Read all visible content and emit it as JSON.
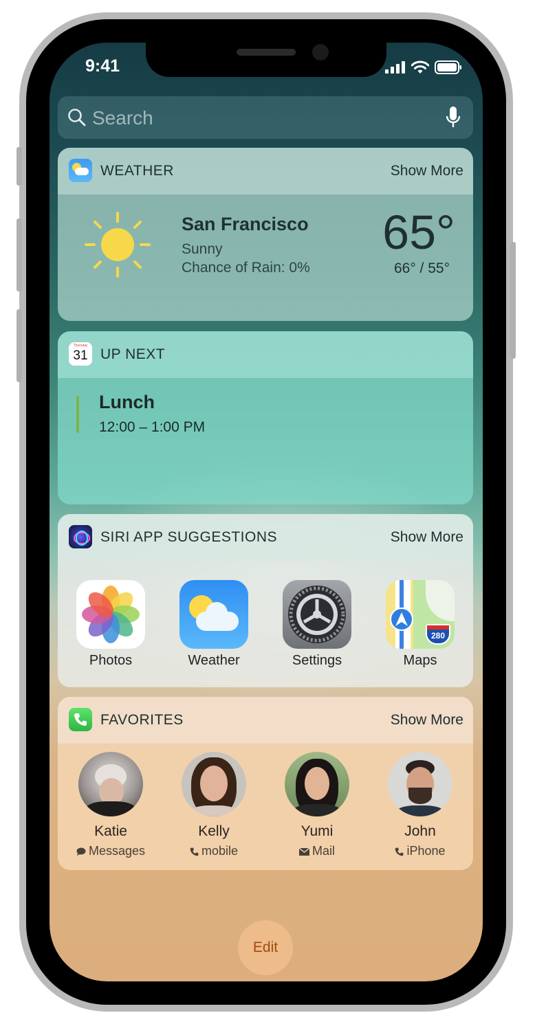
{
  "status": {
    "time": "9:41"
  },
  "search": {
    "placeholder": "Search"
  },
  "weather_widget": {
    "title": "WEATHER",
    "show_more": "Show More",
    "city": "San Francisco",
    "condition": "Sunny",
    "rain": "Chance of Rain: 0%",
    "temp": "65°",
    "hi_lo": "66° / 55°"
  },
  "upnext_widget": {
    "title": "UP NEXT",
    "calendar_day_name": "Thursday",
    "calendar_day": "31",
    "event_title": "Lunch",
    "event_time": "12:00 – 1:00 PM",
    "event_color": "#7ab648"
  },
  "siri_widget": {
    "title": "SIRI APP SUGGESTIONS",
    "show_more": "Show More",
    "apps": [
      {
        "label": "Photos",
        "icon": "photos-icon"
      },
      {
        "label": "Weather",
        "icon": "weather-app-icon"
      },
      {
        "label": "Settings",
        "icon": "settings-gear-icon"
      },
      {
        "label": "Maps",
        "icon": "maps-icon"
      }
    ],
    "maps_badge": "280"
  },
  "favorites_widget": {
    "title": "FAVORITES",
    "show_more": "Show More",
    "contacts": [
      {
        "name": "Katie",
        "method": "Messages",
        "method_icon": "message-bubble-icon"
      },
      {
        "name": "Kelly",
        "method": "mobile",
        "method_icon": "phone-icon"
      },
      {
        "name": "Yumi",
        "method": "Mail",
        "method_icon": "envelope-icon"
      },
      {
        "name": "John",
        "method": "iPhone",
        "method_icon": "phone-icon"
      }
    ]
  },
  "edit_button": {
    "label": "Edit"
  },
  "colors": {
    "weather_widget_bg": "#9fd0c6",
    "upnext_widget_bg": "#8fd8c9",
    "siri_widget_bg": "#e6e7e3",
    "favorites_widget_bg": "#f3dcc0",
    "sun": "#f7d84a",
    "edit_text": "#a04a10"
  }
}
